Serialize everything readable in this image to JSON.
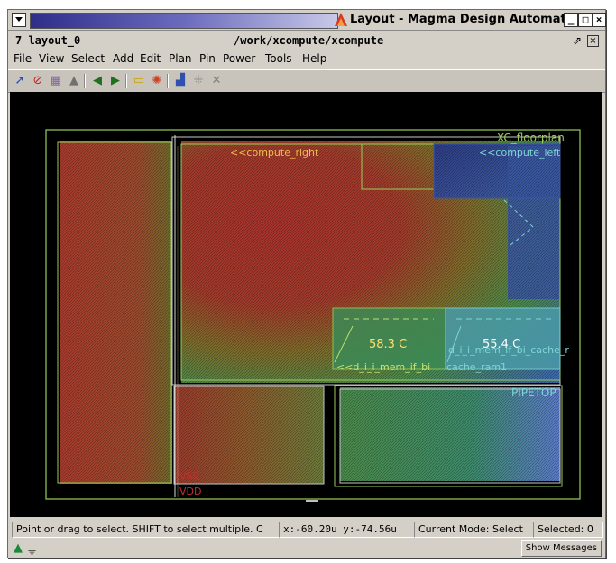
{
  "window": {
    "title": "Layout - Magma Design Automation",
    "buttons": {
      "minimize": "_",
      "maximize": "□",
      "close": "×"
    }
  },
  "subheader": {
    "layout_id": "7  layout_0",
    "path": "/work/xcompute/xcompute"
  },
  "menu": {
    "items": [
      "File",
      "View",
      "Select",
      "Add",
      "Edit",
      "Plan",
      "Pin",
      "Power",
      "Tools",
      "Help"
    ]
  },
  "toolbar": {
    "icons": [
      "select-arrow-icon",
      "no-select-icon",
      "select-area-icon",
      "move-icon",
      "prev-icon",
      "next-icon",
      "ruler-icon",
      "heat-icon",
      "route-icon",
      "snap-icon",
      "delete-icon"
    ]
  },
  "canvas": {
    "floorplan_label": "XC_floorplan",
    "compute_right_label": "<<compute_right",
    "compute_left_label": "<<compute_left",
    "temp_left": "58.3 C",
    "temp_right": "55.4 C",
    "mem_label_left": "<<d_i_i_mem_if_bi",
    "mem_label_mid": "cache_ram1",
    "mem_label_right": "d_i_i_mem_if_bi_cache_r",
    "pipetop_label": "PIPETOP",
    "vss_label": "VSS",
    "vdd_label": "VDD",
    "colors": {
      "hot": "#a8322c",
      "warm": "#7d6a2a",
      "cool": "#3c8a56",
      "cold": "#3c5ea8",
      "outline": "#9acd5a",
      "cyan": "#7fd6d6"
    }
  },
  "status": {
    "hint": "Point or drag to select. SHIFT to select multiple. C",
    "coords": "x:-60.20u y:-74.56u",
    "mode": "Current Mode: Select",
    "selected": "Selected: 0"
  },
  "bottom": {
    "show_messages": "Show Messages"
  }
}
